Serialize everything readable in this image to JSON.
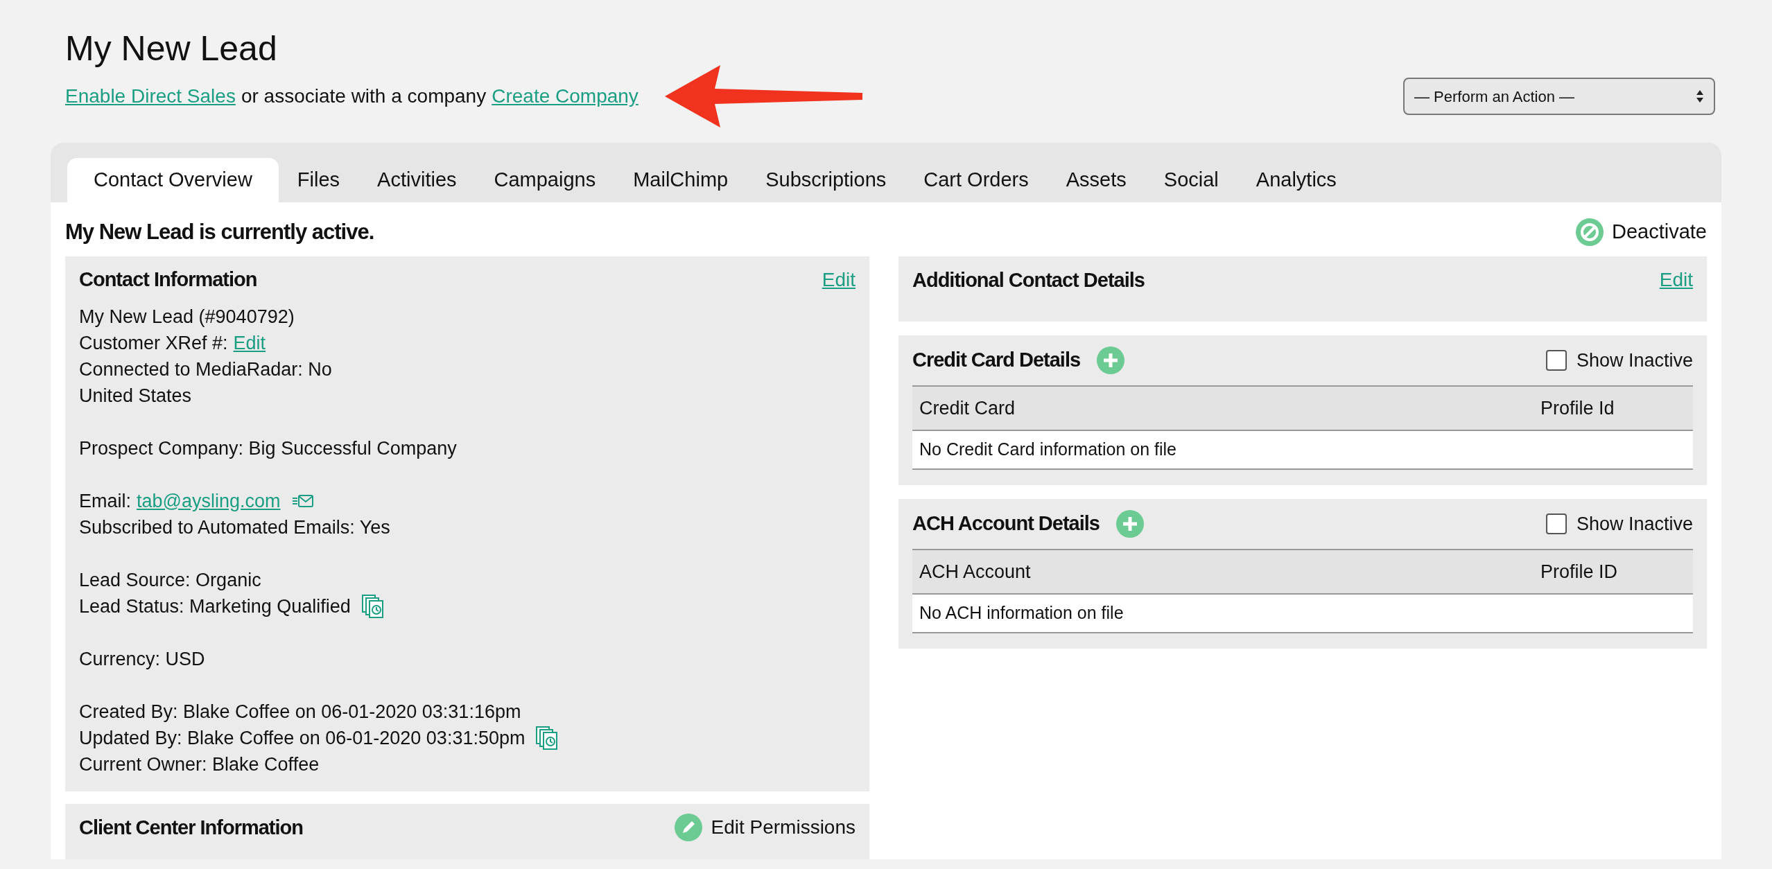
{
  "page_title": "My New Lead",
  "subtitle": {
    "link_1": "Enable Direct Sales",
    "text": "or associate with a company",
    "link_2": "Create Company"
  },
  "action_select": {
    "value": "— Perform an Action —"
  },
  "tabs": [
    {
      "label": "Contact Overview",
      "selected": true
    },
    {
      "label": "Files",
      "selected": false
    },
    {
      "label": "Activities",
      "selected": false
    },
    {
      "label": "Campaigns",
      "selected": false
    },
    {
      "label": "MailChimp",
      "selected": false
    },
    {
      "label": "Subscriptions",
      "selected": false
    },
    {
      "label": "Cart Orders",
      "selected": false
    },
    {
      "label": "Assets",
      "selected": false
    },
    {
      "label": "Social",
      "selected": false
    },
    {
      "label": "Analytics",
      "selected": false
    }
  ],
  "status_text": "My New Lead is currently active.",
  "deactivate_button": "Deactivate",
  "contact_information": {
    "title": "Contact Information",
    "edit": "Edit",
    "groups": [
      [
        {
          "text": "My New Lead (#9040792)"
        },
        {
          "text": "Customer XRef #:",
          "link": "Edit"
        },
        {
          "text": "Connected to MediaRadar: No"
        },
        {
          "text": "United States"
        }
      ],
      [
        {
          "text": "Prospect Company: Big Successful Company"
        }
      ],
      [
        {
          "text": "Email:",
          "link": "tab@aysling.com",
          "kind": "email"
        },
        {
          "text": "Subscribed to Automated Emails: Yes"
        }
      ],
      [
        {
          "text": "Lead Source: Organic"
        },
        {
          "text": "Lead Status: Marketing Qualified",
          "kind": "history"
        }
      ],
      [
        {
          "text": "Currency: USD"
        }
      ],
      [
        {
          "text": "Created By: Blake Coffee on 06-01-2020 03:31:16pm"
        },
        {
          "text": "Updated By: Blake Coffee on 06-01-2020 03:31:50pm",
          "kind": "history"
        },
        {
          "text": "Current Owner: Blake Coffee"
        }
      ]
    ]
  },
  "client_center": {
    "title": "Client Center Information",
    "button": "Edit Permissions"
  },
  "additional_contact_details": {
    "title": "Additional Contact Details",
    "edit": "Edit"
  },
  "payment_sections": [
    {
      "title": "Credit Card Details",
      "show_inactive": {
        "label": "Show Inactive",
        "checked": false
      },
      "columns": [
        "Credit Card",
        "Profile Id"
      ],
      "empty_message": "No Credit Card information on file"
    },
    {
      "title": "ACH Account Details",
      "show_inactive": {
        "label": "Show Inactive",
        "checked": false
      },
      "columns": [
        "ACH Account",
        "Profile ID"
      ],
      "empty_message": "No ACH information on file"
    }
  ]
}
